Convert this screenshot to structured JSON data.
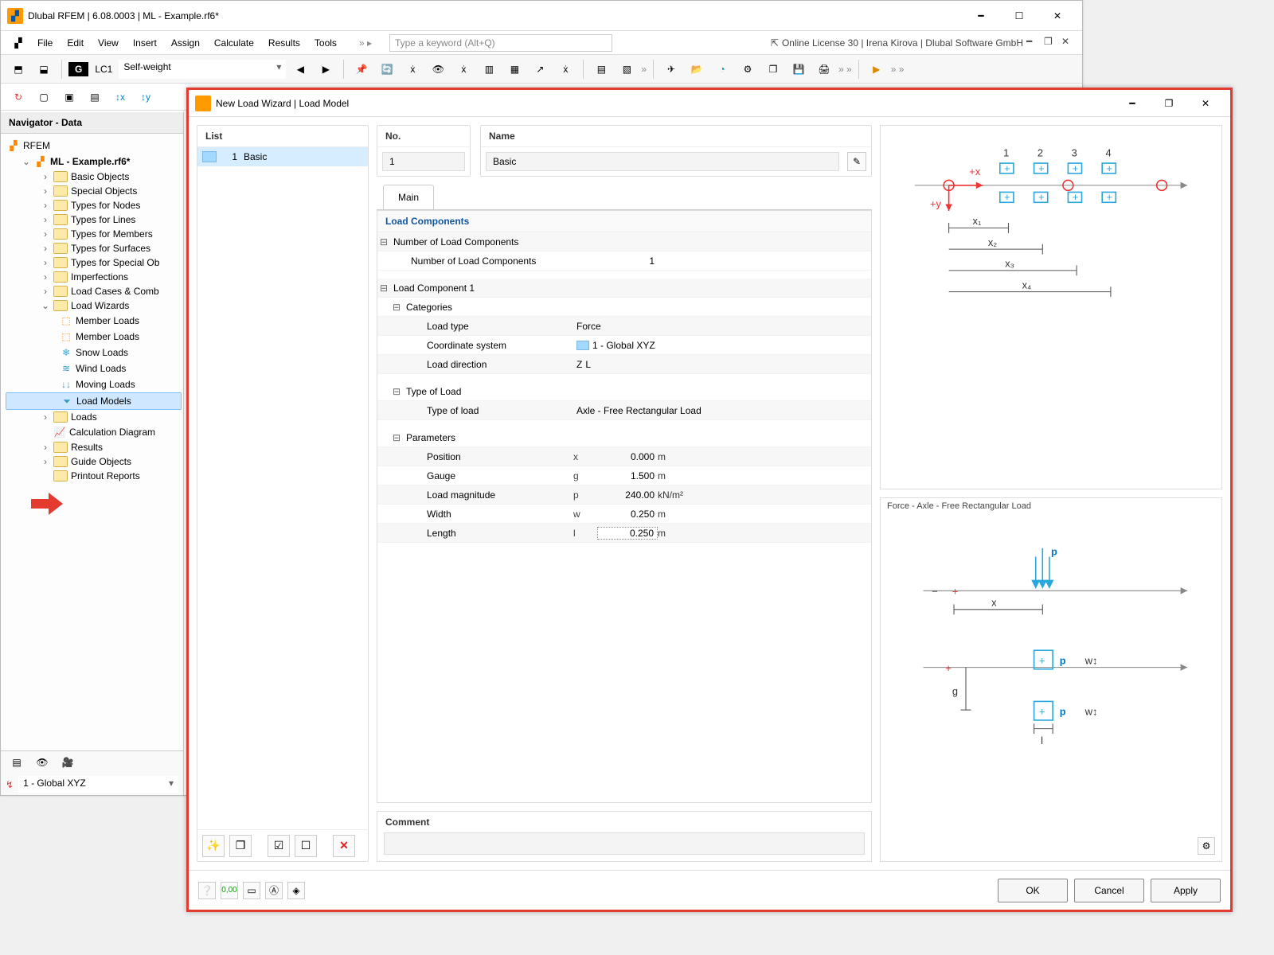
{
  "window": {
    "title": "Dlubal RFEM | 6.08.0003 | ML - Example.rf6*",
    "license_status": "Online License 30 | Irena Kirova | Dlubal Software GmbH",
    "search_placeholder": "Type a keyword (Alt+Q)"
  },
  "menu": {
    "items": [
      "File",
      "Edit",
      "View",
      "Insert",
      "Assign",
      "Calculate",
      "Results",
      "Tools"
    ]
  },
  "loadcase": {
    "group": "G",
    "id": "LC1",
    "name": "Self-weight"
  },
  "navigator": {
    "title": "Navigator - Data",
    "root": "RFEM",
    "project": "ML - Example.rf6*",
    "folders": [
      "Basic Objects",
      "Special Objects",
      "Types for Nodes",
      "Types for Lines",
      "Types for Members",
      "Types for Surfaces",
      "Types for Special Ob",
      "Imperfections",
      "Load Cases & Comb"
    ],
    "load_wizards": {
      "label": "Load Wizards",
      "children": [
        "Member Loads",
        "Member Loads",
        "Snow Loads",
        "Wind Loads",
        "Moving Loads",
        "Load Models"
      ]
    },
    "folders_after": [
      "Loads",
      "Calculation Diagram",
      "Results",
      "Guide Objects",
      "Printout Reports"
    ],
    "coord_system": "1 - Global XYZ"
  },
  "dialog": {
    "title": "New Load Wizard | Load Model",
    "list_header": "List",
    "list": [
      {
        "num": "1",
        "name": "Basic"
      }
    ],
    "no_header": "No.",
    "no_value": "1",
    "name_header": "Name",
    "name_value": "Basic",
    "tab_main": "Main",
    "sections": {
      "load_components": "Load Components",
      "num_components_group": "Number of Load Components",
      "num_components_label": "Number of Load Components",
      "num_components_value": "1",
      "component1": "Load Component 1",
      "categories": "Categories",
      "load_type_label": "Load type",
      "load_type_value": "Force",
      "coord_system_label": "Coordinate system",
      "coord_system_value": "1 - Global XYZ",
      "load_direction_label": "Load direction",
      "load_direction_value": "Z",
      "load_direction_sub": "L",
      "type_of_load_group": "Type of Load",
      "type_of_load_label": "Type of load",
      "type_of_load_value": "Axle - Free Rectangular Load",
      "parameters": "Parameters",
      "position_label": "Position",
      "position_sym": "x",
      "position_val": "0.000",
      "position_unit": "m",
      "gauge_label": "Gauge",
      "gauge_sym": "g",
      "gauge_val": "1.500",
      "gauge_unit": "m",
      "magnitude_label": "Load magnitude",
      "magnitude_sym": "p",
      "magnitude_val": "240.00",
      "magnitude_unit": "kN/m²",
      "width_label": "Width",
      "width_sym": "w",
      "width_val": "0.250",
      "width_unit": "m",
      "length_label": "Length",
      "length_sym": "l",
      "length_val": "0.250",
      "length_unit": "m"
    },
    "comment_header": "Comment",
    "illus2_caption": "Force - Axle - Free Rectangular Load",
    "buttons": {
      "ok": "OK",
      "cancel": "Cancel",
      "apply": "Apply"
    }
  }
}
